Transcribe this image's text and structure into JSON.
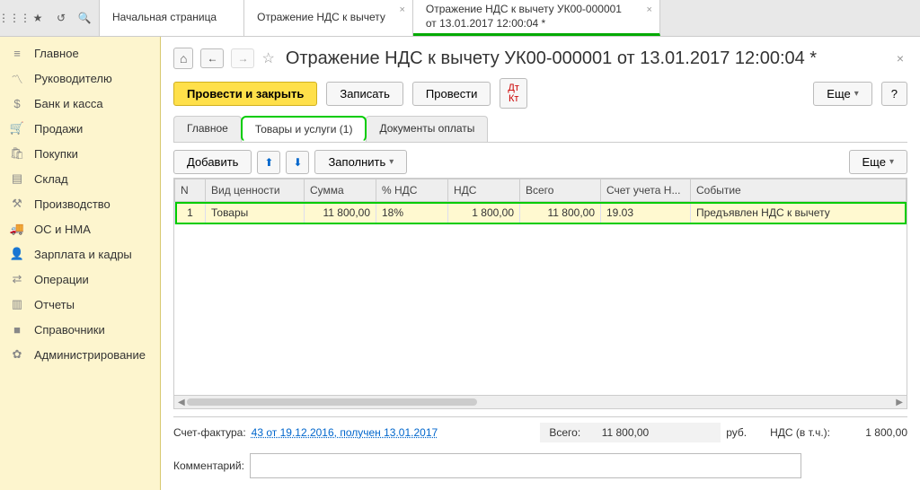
{
  "top_tabs": {
    "t0": "Начальная страница",
    "t1": "Отражение НДС к вычету",
    "t2": "Отражение НДС к вычету УК00-000001 от 13.01.2017 12:00:04 *"
  },
  "sidebar": {
    "items": [
      {
        "label": "Главное",
        "icon": "≡"
      },
      {
        "label": "Руководителю",
        "icon": "📈"
      },
      {
        "label": "Банк и касса",
        "icon": "💰"
      },
      {
        "label": "Продажи",
        "icon": "🛒"
      },
      {
        "label": "Покупки",
        "icon": "🛍"
      },
      {
        "label": "Склад",
        "icon": "📦"
      },
      {
        "label": "Производство",
        "icon": "🏭"
      },
      {
        "label": "ОС и НМА",
        "icon": "🚚"
      },
      {
        "label": "Зарплата и кадры",
        "icon": "👥"
      },
      {
        "label": "Операции",
        "icon": "⇄"
      },
      {
        "label": "Отчеты",
        "icon": "📊"
      },
      {
        "label": "Справочники",
        "icon": "📁"
      },
      {
        "label": "Администрирование",
        "icon": "⚙"
      }
    ]
  },
  "doc": {
    "title": "Отражение НДС к вычету УК00-000001 от 13.01.2017 12:00:04 *"
  },
  "toolbar": {
    "post_close": "Провести и закрыть",
    "write": "Записать",
    "post": "Провести",
    "more": "Еще",
    "help": "?"
  },
  "inner_tabs": {
    "t0": "Главное",
    "t1": "Товары и услуги (1)",
    "t2": "Документы оплаты"
  },
  "sub_toolbar": {
    "add": "Добавить",
    "fill": "Заполнить",
    "more": "Еще"
  },
  "grid": {
    "headers": {
      "n": "N",
      "type": "Вид ценности",
      "sum": "Сумма",
      "vat_pct": "% НДС",
      "vat": "НДС",
      "total": "Всего",
      "account": "Счет учета Н...",
      "event": "Событие"
    },
    "rows": [
      {
        "n": "1",
        "type": "Товары",
        "sum": "11 800,00",
        "vat_pct": "18%",
        "vat": "1 800,00",
        "total": "11 800,00",
        "account": "19.03",
        "event": "Предъявлен НДС к вычету"
      }
    ]
  },
  "footer": {
    "invoice_label": "Счет-фактура:",
    "invoice_link": "43 от 19.12.2016, получен 13.01.2017",
    "total_label": "Всего:",
    "total_value": "11 800,00",
    "total_curr": "руб.",
    "vat_label": "НДС (в т.ч.):",
    "vat_value": "1 800,00",
    "comment_label": "Комментарий:"
  }
}
